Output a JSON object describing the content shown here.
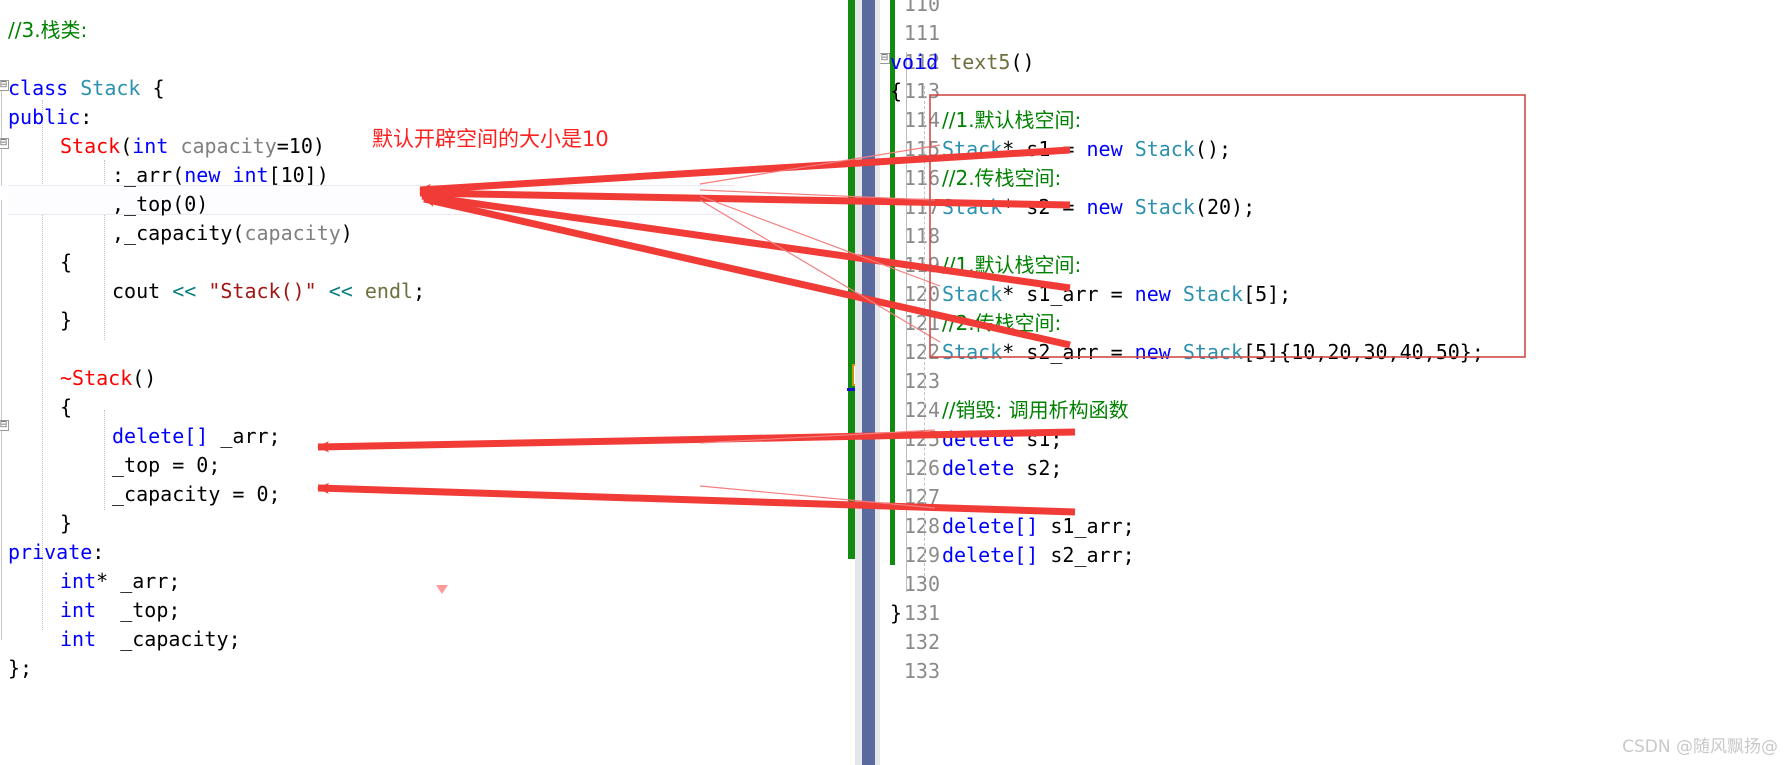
{
  "editor": {
    "app": "visual-studio-code-editor",
    "left_pane": {
      "name": "stack-class-definition",
      "lines": [
        {
          "indent": 0,
          "tokens": [
            {
              "t": "//3.栈类:",
              "c": "cmt",
              "cn": true
            }
          ]
        },
        {
          "indent": 0,
          "tokens": []
        },
        {
          "indent": 0,
          "tokens": [
            {
              "t": "class ",
              "c": "kw"
            },
            {
              "t": "Stack",
              "c": "type"
            },
            {
              "t": " {",
              "c": "plain"
            }
          ]
        },
        {
          "indent": 0,
          "tokens": [
            {
              "t": "public",
              "c": "kw"
            },
            {
              "t": ":",
              "c": "plain"
            }
          ]
        },
        {
          "indent": 1,
          "tokens": [
            {
              "t": "Stack",
              "c": "ctor"
            },
            {
              "t": "(",
              "c": "plain"
            },
            {
              "t": "int ",
              "c": "kw"
            },
            {
              "t": "capacity",
              "c": "param"
            },
            {
              "t": "=10)",
              "c": "plain"
            }
          ]
        },
        {
          "indent": 2,
          "tokens": [
            {
              "t": ":_arr(",
              "c": "plain"
            },
            {
              "t": "new ",
              "c": "kw"
            },
            {
              "t": "int",
              "c": "kw"
            },
            {
              "t": "[10])",
              "c": "plain"
            }
          ]
        },
        {
          "indent": 2,
          "tokens": [
            {
              "t": ",_top(0)",
              "c": "plain"
            }
          ]
        },
        {
          "indent": 2,
          "tokens": [
            {
              "t": ",_capacity(",
              "c": "plain"
            },
            {
              "t": "capacity",
              "c": "param"
            },
            {
              "t": ")",
              "c": "plain"
            }
          ]
        },
        {
          "indent": 1,
          "tokens": [
            {
              "t": "{",
              "c": "plain"
            }
          ]
        },
        {
          "indent": 2,
          "tokens": [
            {
              "t": "cout ",
              "c": "plain"
            },
            {
              "t": "<< ",
              "c": "op"
            },
            {
              "t": "\"Stack()\"",
              "c": "str"
            },
            {
              "t": " << ",
              "c": "op"
            },
            {
              "t": "endl",
              "c": "ident"
            },
            {
              "t": ";",
              "c": "plain"
            }
          ]
        },
        {
          "indent": 1,
          "tokens": [
            {
              "t": "}",
              "c": "plain"
            }
          ]
        },
        {
          "indent": 0,
          "tokens": []
        },
        {
          "indent": 1,
          "tokens": [
            {
              "t": "~Stack",
              "c": "ctor"
            },
            {
              "t": "()",
              "c": "plain"
            }
          ]
        },
        {
          "indent": 1,
          "tokens": [
            {
              "t": "{",
              "c": "plain"
            }
          ]
        },
        {
          "indent": 2,
          "tokens": [
            {
              "t": "delete[]",
              "c": "kw"
            },
            {
              "t": " _arr;",
              "c": "plain"
            }
          ]
        },
        {
          "indent": 2,
          "tokens": [
            {
              "t": "_top = 0;",
              "c": "plain"
            }
          ]
        },
        {
          "indent": 2,
          "tokens": [
            {
              "t": "_capacity = 0;",
              "c": "plain"
            }
          ]
        },
        {
          "indent": 1,
          "tokens": [
            {
              "t": "}",
              "c": "plain"
            }
          ]
        },
        {
          "indent": 0,
          "tokens": [
            {
              "t": "private",
              "c": "kw"
            },
            {
              "t": ":",
              "c": "plain"
            }
          ]
        },
        {
          "indent": 1,
          "tokens": [
            {
              "t": "int",
              "c": "kw"
            },
            {
              "t": "* _arr;",
              "c": "plain"
            }
          ]
        },
        {
          "indent": 1,
          "tokens": [
            {
              "t": "int",
              "c": "kw"
            },
            {
              "t": "  _top;",
              "c": "plain"
            }
          ]
        },
        {
          "indent": 1,
          "tokens": [
            {
              "t": "int",
              "c": "kw"
            },
            {
              "t": "  _capacity;",
              "c": "plain"
            }
          ]
        },
        {
          "indent": 0,
          "tokens": [
            {
              "t": "};",
              "c": "plain"
            }
          ]
        }
      ]
    },
    "right_pane": {
      "name": "text5-function",
      "line_numbers": [
        "110",
        "111",
        "112",
        "113",
        "114",
        "115",
        "116",
        "117",
        "118",
        "119",
        "120",
        "121",
        "122",
        "123",
        "124",
        "125",
        "126",
        "127",
        "128",
        "129",
        "130",
        "131",
        "132",
        "133"
      ],
      "lines": [
        {
          "num": "110",
          "indent": 0,
          "tokens": []
        },
        {
          "num": "111",
          "indent": 0,
          "tokens": []
        },
        {
          "num": "112",
          "indent": 0,
          "tokens": [
            {
              "t": "void ",
              "c": "kw"
            },
            {
              "t": "text5",
              "c": "ident"
            },
            {
              "t": "()",
              "c": "plain"
            }
          ]
        },
        {
          "num": "113",
          "indent": 0,
          "tokens": [
            {
              "t": "{",
              "c": "plain"
            }
          ]
        },
        {
          "num": "114",
          "indent": 1,
          "tokens": [
            {
              "t": "//1.默认栈空间:",
              "c": "cmt",
              "cn": true
            }
          ]
        },
        {
          "num": "115",
          "indent": 1,
          "tokens": [
            {
              "t": "Stack",
              "c": "type"
            },
            {
              "t": "* s1 = ",
              "c": "plain"
            },
            {
              "t": "new ",
              "c": "kw"
            },
            {
              "t": "Stack",
              "c": "type"
            },
            {
              "t": "();",
              "c": "plain"
            }
          ]
        },
        {
          "num": "116",
          "indent": 1,
          "tokens": [
            {
              "t": "//2.传栈空间:",
              "c": "cmt",
              "cn": true
            }
          ]
        },
        {
          "num": "117",
          "indent": 1,
          "tokens": [
            {
              "t": "Stack",
              "c": "type"
            },
            {
              "t": "* s2 = ",
              "c": "plain"
            },
            {
              "t": "new ",
              "c": "kw"
            },
            {
              "t": "Stack",
              "c": "type"
            },
            {
              "t": "(20);",
              "c": "plain"
            }
          ]
        },
        {
          "num": "118",
          "indent": 1,
          "tokens": []
        },
        {
          "num": "119",
          "indent": 1,
          "tokens": [
            {
              "t": "//1.默认栈空间:",
              "c": "cmt",
              "cn": true
            }
          ]
        },
        {
          "num": "120",
          "indent": 1,
          "tokens": [
            {
              "t": "Stack",
              "c": "type"
            },
            {
              "t": "* s1_arr = ",
              "c": "plain"
            },
            {
              "t": "new ",
              "c": "kw"
            },
            {
              "t": "Stack",
              "c": "type"
            },
            {
              "t": "[5];",
              "c": "plain"
            }
          ]
        },
        {
          "num": "121",
          "indent": 1,
          "tokens": [
            {
              "t": "//2.传栈空间:",
              "c": "cmt",
              "cn": true
            }
          ]
        },
        {
          "num": "122",
          "indent": 1,
          "tokens": [
            {
              "t": "Stack",
              "c": "type"
            },
            {
              "t": "* s2_arr = ",
              "c": "plain"
            },
            {
              "t": "new ",
              "c": "kw"
            },
            {
              "t": "Stack",
              "c": "type"
            },
            {
              "t": "[5]{10,20,30,40,50};",
              "c": "plain"
            }
          ]
        },
        {
          "num": "123",
          "indent": 1,
          "tokens": []
        },
        {
          "num": "124",
          "indent": 1,
          "tokens": [
            {
              "t": "//销毁: 调用析构函数",
              "c": "cmt",
              "cn": true
            }
          ]
        },
        {
          "num": "125",
          "indent": 1,
          "tokens": [
            {
              "t": "delete",
              "c": "kw"
            },
            {
              "t": " s1;",
              "c": "plain"
            }
          ]
        },
        {
          "num": "126",
          "indent": 1,
          "tokens": [
            {
              "t": "delete",
              "c": "kw"
            },
            {
              "t": " s2;",
              "c": "plain"
            }
          ]
        },
        {
          "num": "127",
          "indent": 1,
          "tokens": []
        },
        {
          "num": "128",
          "indent": 1,
          "tokens": [
            {
              "t": "delete[]",
              "c": "kw"
            },
            {
              "t": " s1_arr;",
              "c": "plain"
            }
          ]
        },
        {
          "num": "129",
          "indent": 1,
          "tokens": [
            {
              "t": "delete[]",
              "c": "kw"
            },
            {
              "t": " s2_arr;",
              "c": "plain"
            }
          ]
        },
        {
          "num": "130",
          "indent": 1,
          "tokens": []
        },
        {
          "num": "131",
          "indent": 0,
          "tokens": [
            {
              "t": "}",
              "c": "plain"
            }
          ]
        },
        {
          "num": "132",
          "indent": 0,
          "tokens": []
        },
        {
          "num": "133",
          "indent": 0,
          "tokens": []
        }
      ]
    }
  },
  "annotations": {
    "red_note": "默认开辟空间的大小是10",
    "red_note_color": "#ff2020",
    "box_color": "#d04a4a",
    "arrow_color": "#f03b36"
  },
  "watermark": {
    "text": "CSDN @随风飘扬@"
  },
  "colors": {
    "comment_green": "#008000",
    "keyword_blue": "#0000ff",
    "type_teal": "#2b91af",
    "string_dark_red": "#a31515",
    "ctor_red": "#ff0000",
    "line_number_gray": "#8a8a8a",
    "change_bar_green": "#138a10",
    "scrollbar_blue": "#5b6a9e",
    "scrollbar_track": "#e6e7eb",
    "scrollbar_thumb": "#c2c3c9",
    "bookmark_orange": "#c8960c",
    "mark_blue": "#1111cc"
  }
}
